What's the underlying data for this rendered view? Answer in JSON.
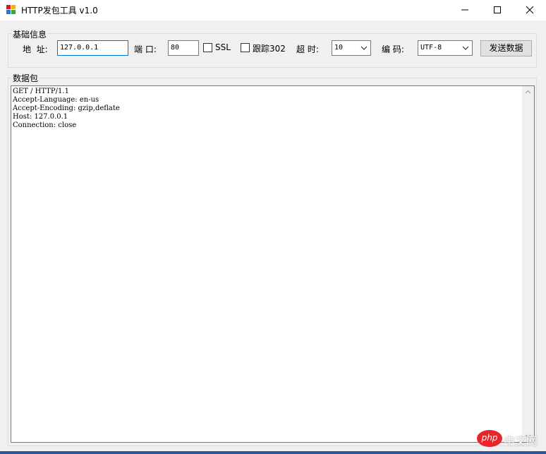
{
  "window": {
    "title": "HTTP发包工具 v1.0",
    "controls": [
      "minimize",
      "maximize",
      "close"
    ]
  },
  "basic_group": {
    "title": "基础信息",
    "address": {
      "label": "地  址:",
      "value": "127.0.0.1"
    },
    "port": {
      "label": "端 口:",
      "value": "80"
    },
    "ssl": {
      "label": "SSL",
      "checked": false
    },
    "redirect": {
      "label": "跟踪302",
      "checked": false
    },
    "timeout": {
      "label": "超 时:",
      "value": "10"
    },
    "encoding": {
      "label": "编 码:",
      "value": "UTF-8"
    },
    "send_label": "发送数据"
  },
  "packet_group": {
    "title": "数据包",
    "content": "GET / HTTP/1.1\nAccept-Language: en-us\nAccept-Encoding: gzip,deflate\nHost: 127.0.0.1\nConnection: close"
  },
  "watermark": {
    "logo": "php",
    "text": "中文网"
  },
  "colors": {
    "accent_focus": "#0078d7",
    "watermark": "#e8262a",
    "taskbar": "#2b579a"
  }
}
